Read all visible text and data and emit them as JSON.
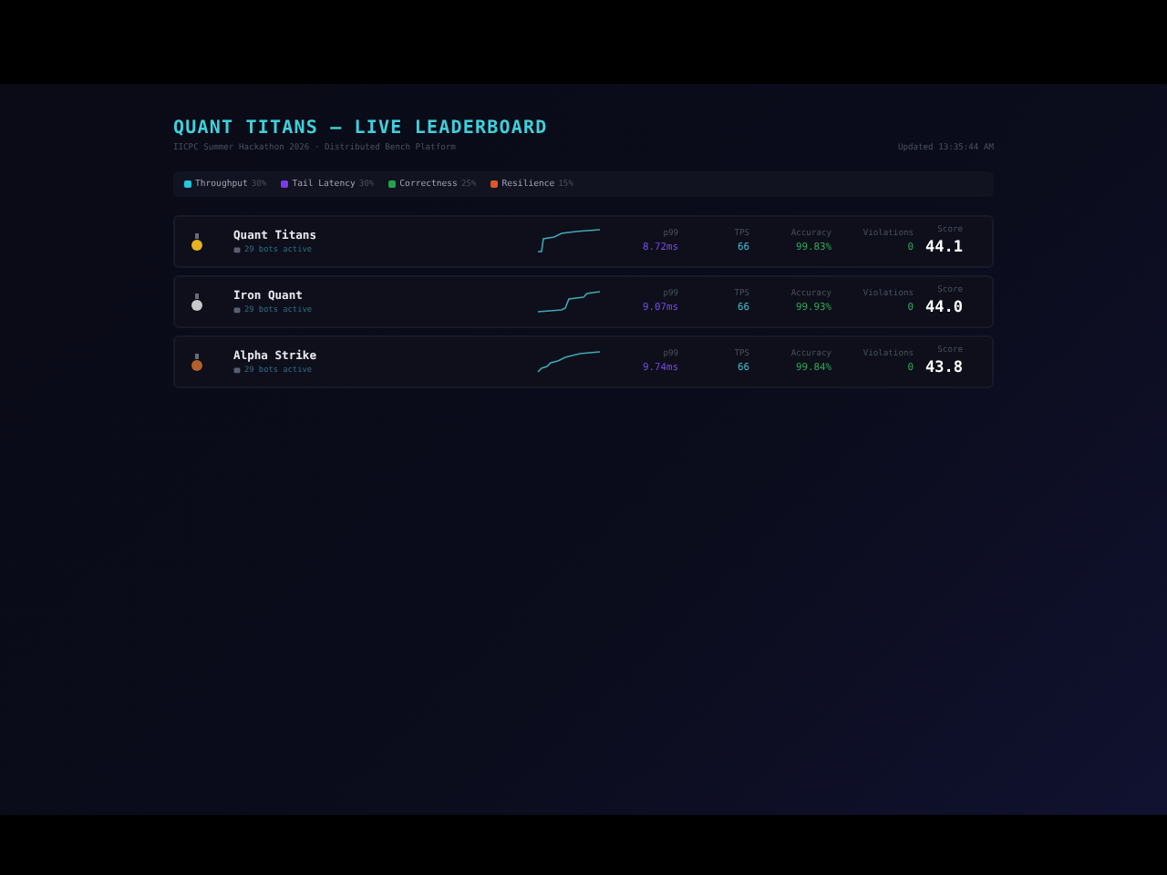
{
  "header": {
    "title": "QUANT TITANS — LIVE LEADERBOARD",
    "subtitle": "IICPC Summer Hackathon 2026 · Distributed Bench Platform",
    "updated": "Updated 13:35:44 AM"
  },
  "legend": [
    {
      "label": "Throughput",
      "weight": "30%",
      "color": "#22c8dc"
    },
    {
      "label": "Tail Latency",
      "weight": "30%",
      "color": "#7c3aed"
    },
    {
      "label": "Correctness",
      "weight": "25%",
      "color": "#22a34a"
    },
    {
      "label": "Resilience",
      "weight": "15%",
      "color": "#e0562a"
    }
  ],
  "rows": [
    {
      "name": "Quant Titans",
      "bots": "29 bots active",
      "color": "#e6b422",
      "p99_label": "p99",
      "p99": "8.72ms",
      "tps_label": "TPS",
      "tps": "66",
      "accuracy_label": "Accuracy",
      "accuracy": "99.83%",
      "violations_label": "Violations",
      "violations": "0",
      "score_label": "Score",
      "score": "44.1"
    },
    {
      "name": "Iron Quant",
      "bots": "29 bots active",
      "color": "#c8c8cc",
      "p99_label": "p99",
      "p99": "9.07ms",
      "tps_label": "TPS",
      "tps": "66",
      "accuracy_label": "Accuracy",
      "accuracy": "99.93%",
      "violations_label": "Violations",
      "violations": "0",
      "score_label": "Score",
      "score": "44.0"
    },
    {
      "name": "Alpha Strike",
      "bots": "29 bots active",
      "color": "#b5602a",
      "p99_label": "p99",
      "p99": "9.74ms",
      "tps_label": "TPS",
      "tps": "66",
      "accuracy_label": "Accuracy",
      "accuracy": "99.84%",
      "violations_label": "Violations",
      "violations": "0",
      "score_label": "Score",
      "score": "43.8"
    }
  ]
}
